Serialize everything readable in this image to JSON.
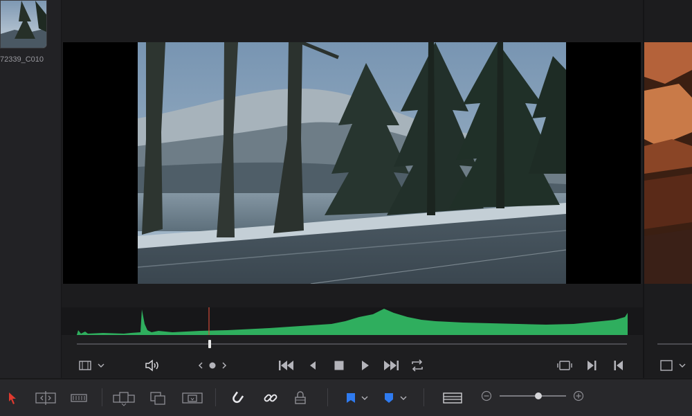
{
  "media_pool": {
    "clip_label": "72339_C010"
  },
  "viewer": {
    "timecode_placeholder": ""
  },
  "transport": {
    "playhead_position": 0.24,
    "icons": [
      "clip-view-icon",
      "audio-icon",
      "prev-marker-icon",
      "marker-dot-icon",
      "next-marker-icon",
      "go-to-start-icon",
      "step-back-icon",
      "stop-icon",
      "play-icon",
      "play-to-end-icon",
      "loop-icon",
      "match-frame-icon",
      "next-clip-icon",
      "prev-clip-icon"
    ]
  },
  "toolbar": {
    "icons": [
      "selection-tool-icon",
      "trim-tool-icon",
      "blade-tool-icon",
      "insert-clip-icon",
      "overwrite-clip-icon",
      "replace-clip-icon",
      "snapping-icon",
      "linked-selection-icon",
      "position-lock-icon",
      "flag-icon",
      "marker-icon",
      "timeline-view-icon",
      "zoom-out-icon",
      "zoom-in-icon"
    ],
    "zoom_level": 0.55,
    "accent_red": "#e03a2f",
    "accent_blue": "#2f7bf0"
  },
  "colors": {
    "waveform": "#2fae5e",
    "playhead": "#d04a3a"
  }
}
